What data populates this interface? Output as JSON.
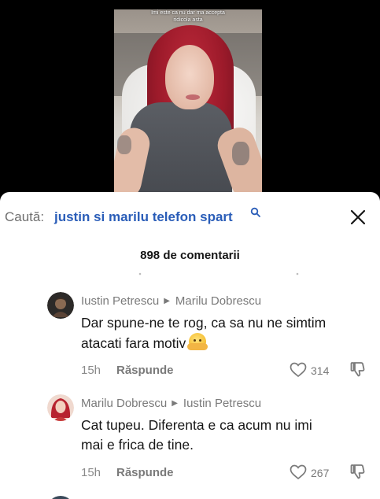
{
  "video": {
    "caption_line1": "Imi este ca nu dar ma accepta",
    "caption_line2": "ridicola asta"
  },
  "search": {
    "prefix": "Caută:",
    "query": "justin si marilu telefon spart"
  },
  "comments_header": {
    "count_label": "898 de comentarii"
  },
  "comments": [
    {
      "author": "Iustin Petrescu",
      "reply_to": "Marilu Dobrescu",
      "text_line1": "Dar spune-ne te rog, ca sa nu ne simtim",
      "text_line2": "atacati fara motiv",
      "emoji": "hugging-face-emoji",
      "time": "15h",
      "reply_label": "Răspunde",
      "likes": "314"
    },
    {
      "author": "Marilu Dobrescu",
      "reply_to": "Iustin Petrescu",
      "text_line1": "Cat tupeu. Diferenta e ca acum nu imi",
      "text_line2": "mai e frica de tine.",
      "time": "15h",
      "reply_label": "Răspunde",
      "likes": "267"
    }
  ],
  "colors": {
    "search_query": "#2a5db8",
    "text_primary": "#161616",
    "text_secondary": "#7a7a7a"
  }
}
